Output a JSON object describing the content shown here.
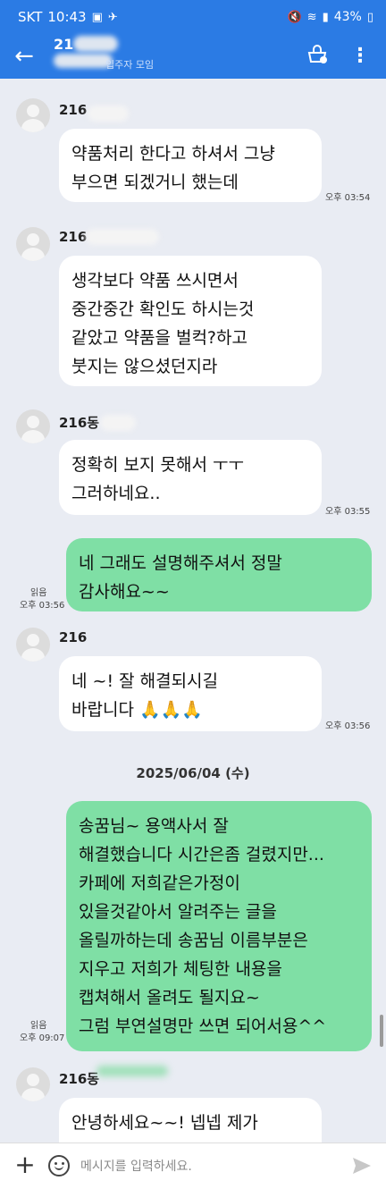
{
  "status": {
    "carrier": "SKT",
    "time": "10:43",
    "battery": "43%"
  },
  "header": {
    "title": "21",
    "subtitle": "입주자 모임",
    "back_icon": "arrow-left-icon"
  },
  "messages": [
    {
      "sender": "216",
      "text": "약품처리 한다고 하셔서 그냥\n부으면 되겠거니 했는데",
      "time": "오후 03:54"
    },
    {
      "sender": "216",
      "text": "생각보다 약품 쓰시면서\n중간중간 확인도 하시는것\n같았고 약품을 벌컥?하고\n붓지는 않으셨던지라"
    },
    {
      "sender": "216동",
      "text": "정확히 보지 못해서 ㅜㅜ\n그러하네요..",
      "time": "오후 03:55"
    },
    {
      "text": "네 그래도 설명해주셔서 정말\n감사해요~~",
      "read": "읽음",
      "time": "오후 03:56"
    },
    {
      "sender": "216",
      "text": "네 ~! 잘 해결되시길\n바랍니다 🙏🙏🙏",
      "time": "오후 03:56"
    },
    {
      "text": "송꿈님~ 용액사서 잘\n해결했습니다 시간은좀 걸렸지만...\n카페에 저희같은가정이\n있을것같아서 알려주는 글을\n올릴까하는데 송꿈님 이름부분은\n지우고 저희가 체팅한 내용을\n캡쳐해서 올려도 될지요~\n그럼 부연설명만 쓰면 되어서용^^",
      "read": "읽음",
      "time": "오후 09:07"
    },
    {
      "sender": "216동",
      "text": "안녕하세요~~! 넵넵 제가\n저도 대리해"
    }
  ],
  "date_separator": "2025/06/04 (수)",
  "input": {
    "placeholder": "메시지를 입력하세요."
  },
  "colors": {
    "header": "#2b7be4",
    "my_bubble": "#7fdfa5",
    "background": "#e9ecf3"
  }
}
